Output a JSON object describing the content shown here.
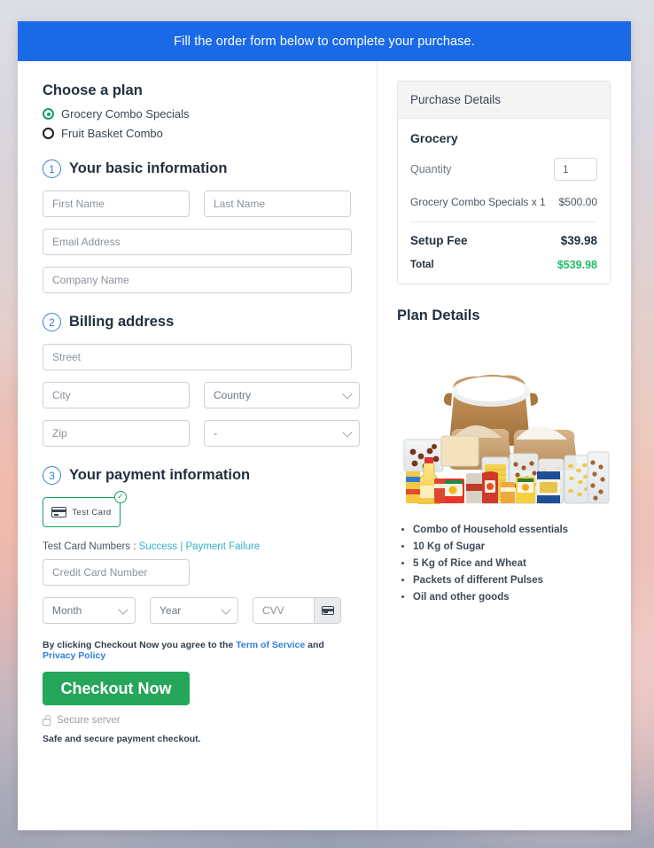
{
  "banner": {
    "text": "Fill the order form below to complete your purchase."
  },
  "plan_chooser": {
    "title": "Choose a plan",
    "options": [
      {
        "label": "Grocery Combo Specials",
        "selected": true
      },
      {
        "label": "Fruit Basket Combo",
        "selected": false
      }
    ]
  },
  "steps": {
    "basic": {
      "number": "1",
      "label": "Your basic information"
    },
    "billing": {
      "number": "2",
      "label": "Billing address"
    },
    "payment": {
      "number": "3",
      "label": "Your payment information"
    }
  },
  "basic_fields": {
    "first_name": {
      "placeholder": "First Name",
      "value": ""
    },
    "last_name": {
      "placeholder": "Last Name",
      "value": ""
    },
    "email": {
      "placeholder": "Email Address",
      "value": ""
    },
    "company": {
      "placeholder": "Company Name",
      "value": ""
    }
  },
  "billing_fields": {
    "street": {
      "placeholder": "Street",
      "value": ""
    },
    "city": {
      "placeholder": "City",
      "value": ""
    },
    "country": {
      "selected": "Country"
    },
    "zip": {
      "placeholder": "Zip",
      "value": ""
    },
    "state": {
      "selected": "-"
    }
  },
  "payment": {
    "method_tile": {
      "label": "Test  Card",
      "icon": "credit-card-icon",
      "selected": true,
      "badge": "✓"
    },
    "test_cards_prefix": "Test Card Numbers : ",
    "test_card_success": "Success",
    "test_card_separator": " | ",
    "test_card_failure": "Payment Failure",
    "credit_card_number": {
      "placeholder": "Credit Card Number",
      "value": ""
    },
    "month": {
      "selected": "Month"
    },
    "year": {
      "selected": "Year"
    },
    "cvv": {
      "placeholder": "CVV",
      "value": ""
    }
  },
  "footer": {
    "terms_prefix": "By clicking Checkout Now you agree to the ",
    "terms_link": "Term of Service",
    "terms_middle": " and ",
    "privacy_link": "Privacy Policy",
    "checkout_label": "Checkout Now",
    "secure_server": "Secure server",
    "safe_note": "Safe and secure payment checkout."
  },
  "purchase_details": {
    "header": "Purchase Details",
    "product_group": "Grocery",
    "quantity_label": "Quantity",
    "quantity_value": "1",
    "line_item": {
      "name": "Grocery Combo Specials x 1",
      "amount": "$500.00"
    },
    "setup_fee": {
      "label": "Setup Fee",
      "amount": "$39.98"
    },
    "total": {
      "label": "Total",
      "amount": "$539.98"
    }
  },
  "plan_details": {
    "title": "Plan Details",
    "image_alt": "grocery-combo-product-photo",
    "features": [
      "Combo of Household essentials",
      "10 Kg of Sugar",
      "5 Kg of Rice and Wheat",
      "Packets of different Pulses",
      "Oil and other goods"
    ]
  },
  "colors": {
    "banner_blue": "#1a6ae8",
    "checkout_green": "#26a65b",
    "total_green": "#1fbd63",
    "link_blue": "#2f7de1",
    "link_teal": "#35b1c4",
    "selected_radio_green": "#14a06a"
  }
}
